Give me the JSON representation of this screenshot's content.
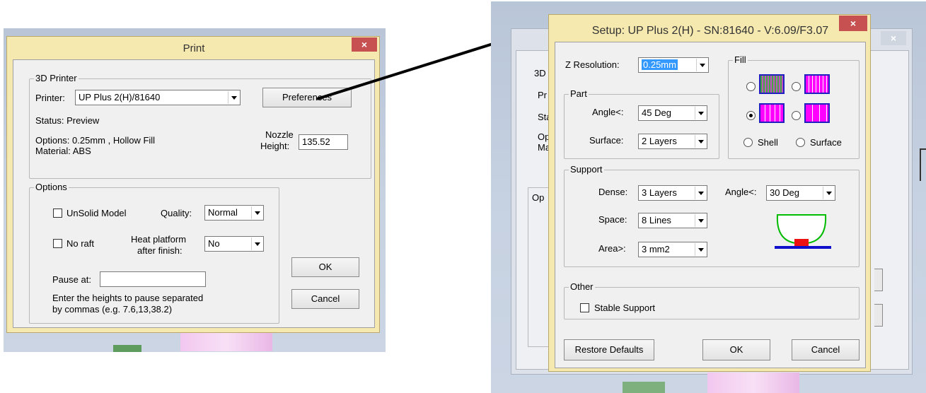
{
  "print_dialog": {
    "title": "Print",
    "close": "×",
    "printer_group_legend": "3D Printer",
    "printer_label": "Printer:",
    "printer_value": "UP Plus 2(H)/81640",
    "preferences_button": "Preferences",
    "status": "Status: Preview",
    "options_line": "Options: 0.25mm , Hollow Fill",
    "material_line": "Material: ABS",
    "nozzle_label_1": "Nozzle",
    "nozzle_label_2": "Height:",
    "nozzle_value": "135.52",
    "options_group_legend": "Options",
    "unsolid_label": "UnSolid Model",
    "quality_label": "Quality:",
    "quality_value": "Normal",
    "noraft_label": "No raft",
    "heat_label_1": "Heat platform",
    "heat_label_2": "after finish:",
    "heat_value": "No",
    "pause_label": "Pause at:",
    "pause_value": "",
    "hint_1": "Enter the heights to pause separated",
    "hint_2": "by commas (e.g. 7.6,13,38.2)",
    "ok_button": "OK",
    "cancel_button": "Cancel"
  },
  "setup_dialog": {
    "title": "Setup: UP Plus 2(H) - SN:81640 - V:6.09/F3.07",
    "close": "×",
    "z_res_label": "Z Resolution:",
    "z_res_value": "0.25mm",
    "part_legend": "Part",
    "angle_label": "Angle<:",
    "angle_value": "45 Deg",
    "surface_label": "Surface:",
    "surface_value": "2 Layers",
    "fill_legend": "Fill",
    "shell_label": "Shell",
    "surface_fill_label": "Surface",
    "support_legend": "Support",
    "dense_label": "Dense:",
    "dense_value": "3 Layers",
    "support_angle_label": "Angle<:",
    "support_angle_value": "30 Deg",
    "space_label": "Space:",
    "space_value": "8 Lines",
    "area_label": "Area>:",
    "area_value": "3 mm2",
    "other_legend": "Other",
    "stable_support_label": "Stable Support",
    "restore_button": "Restore Defaults",
    "ok_button": "OK",
    "cancel_button": "Cancel"
  },
  "background_dialog": {
    "close": "×",
    "partial_labels": [
      "3D",
      "Pr",
      "Sta",
      "Op",
      "Ma",
      "Op"
    ]
  },
  "colors": {
    "frame": "#f5e9b0",
    "close_button": "#c75050",
    "selection": "#3399ff",
    "arrow": "#000000"
  }
}
